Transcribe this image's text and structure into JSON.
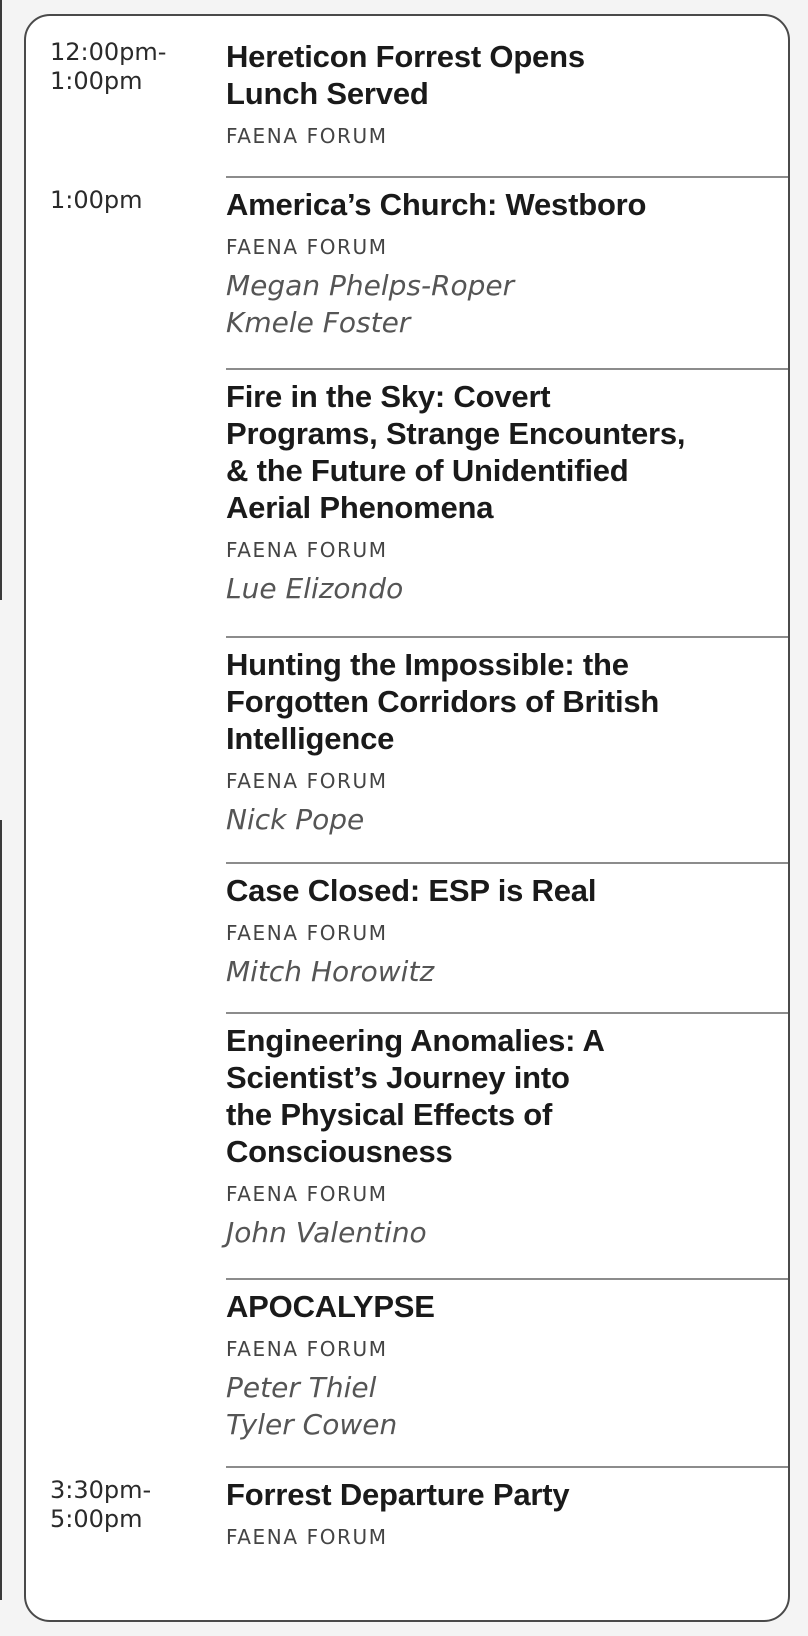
{
  "schedule": [
    {
      "time": "12:00pm-\n1:00pm",
      "title": "Hereticon Forrest Opens\nLunch Served",
      "venue": "FAENA FORUM",
      "speakers": []
    },
    {
      "time": "1:00pm",
      "title": "America’s Church: Westboro",
      "venue": "FAENA FORUM",
      "speakers": [
        "Megan Phelps-Roper",
        "Kmele Foster"
      ]
    },
    {
      "time": "",
      "title": "Fire in the Sky: Covert\nPrograms, Strange Encounters,\n& the Future of Unidentified\nAerial Phenomena",
      "venue": "FAENA FORUM",
      "speakers": [
        "Lue Elizondo"
      ]
    },
    {
      "time": "",
      "title": "Hunting the Impossible: the\nForgotten Corridors of British\nIntelligence",
      "venue": "FAENA FORUM",
      "speakers": [
        "Nick Pope"
      ]
    },
    {
      "time": "",
      "title": "Case Closed: ESP is Real",
      "venue": "FAENA FORUM",
      "speakers": [
        "Mitch Horowitz"
      ]
    },
    {
      "time": "",
      "title": "Engineering Anomalies:  A\nScientist’s Journey into\nthe Physical Effects of\nConsciousness",
      "venue": "FAENA FORUM",
      "speakers": [
        "John Valentino"
      ]
    },
    {
      "time": "",
      "title": "APOCALYPSE",
      "venue": "FAENA FORUM",
      "speakers": [
        "Peter Thiel",
        "Tyler Cowen"
      ]
    },
    {
      "time": "3:30pm-\n5:00pm",
      "title": "Forrest Departure Party",
      "venue": "FAENA FORUM",
      "speakers": []
    }
  ]
}
